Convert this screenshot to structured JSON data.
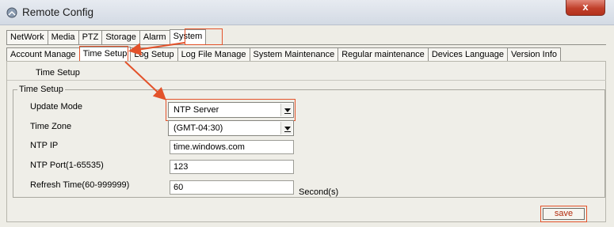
{
  "window": {
    "title": "Remote Config",
    "close_glyph": "x",
    "app_icon": "satellite-dish-icon"
  },
  "top_tabs": [
    {
      "label": "NetWork",
      "selected": false
    },
    {
      "label": "Media",
      "selected": false
    },
    {
      "label": "PTZ",
      "selected": false
    },
    {
      "label": "Storage",
      "selected": false
    },
    {
      "label": "Alarm",
      "selected": false
    },
    {
      "label": "System",
      "selected": true
    }
  ],
  "sub_tabs": [
    {
      "label": "Account Manage",
      "selected": false
    },
    {
      "label": "Time Setup",
      "selected": true
    },
    {
      "label": "Log Setup",
      "selected": false
    },
    {
      "label": "Log File Manage",
      "selected": false
    },
    {
      "label": "System Maintenance",
      "selected": false
    },
    {
      "label": "Regular maintenance",
      "selected": false
    },
    {
      "label": "Devices Language",
      "selected": false
    },
    {
      "label": "Version Info",
      "selected": false
    }
  ],
  "panel": {
    "header": "Time Setup",
    "group_title": "Time Setup",
    "update_mode": {
      "label": "Update Mode",
      "value": "NTP Server"
    },
    "time_zone": {
      "label": "Time Zone",
      "value": "(GMT-04:30)"
    },
    "ntp_ip": {
      "label": "NTP IP",
      "value": "time.windows.com"
    },
    "ntp_port": {
      "label": "NTP Port(1-65535)",
      "value": "123"
    },
    "refresh_time": {
      "label": "Refresh Time(60-999999)",
      "value": "60",
      "unit": "Second(s)"
    }
  },
  "actions": {
    "save_label": "save"
  },
  "colors": {
    "highlight": "#e3522a",
    "close_button": "#c1402b",
    "save_text": "#b22a0c"
  }
}
